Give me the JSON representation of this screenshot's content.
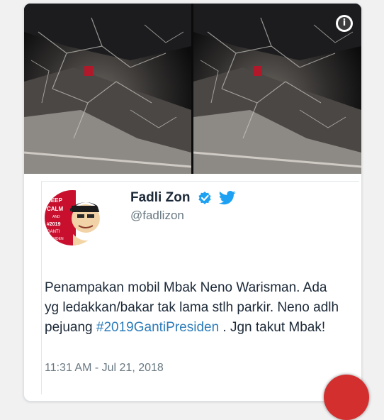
{
  "tweet": {
    "author_name": "Fadli Zon",
    "author_handle": "@fadlizon",
    "text_parts": {
      "before_hashtag": "Penampakan mobil Mbak Neno Warisman. Ada yg ledakkan/bakar tak lama stlh parkir. Neno adlh pejuang ",
      "hashtag": "#2019GantiPresiden",
      "after_hashtag": " . Jgn takut Mbak!"
    },
    "timestamp": "11:31 AM - Jul 21, 2018",
    "verified": true
  },
  "avatar": {
    "badge_lines": [
      "KEEP",
      "CALM",
      "AND",
      "#2019",
      "GANTI",
      "PRESIDEN"
    ]
  },
  "media": {
    "photos": [
      "burned-car-photo",
      "burned-car-photo"
    ],
    "info_icon": "info-icon"
  },
  "colors": {
    "text": "#1c2938",
    "secondary_text": "#697882",
    "link": "#2b7bb9",
    "verified_blue": "#1da1f2",
    "avatar_red": "#c8102e",
    "fab_red": "#d32f2f"
  }
}
